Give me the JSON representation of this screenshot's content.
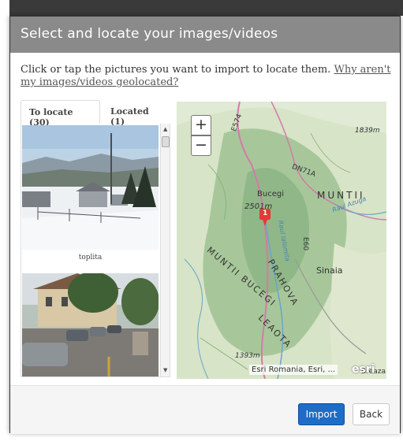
{
  "dialog": {
    "title": "Select and locate your images/videos",
    "intro_text": "Click or tap the pictures you want to import to locate them. ",
    "intro_link": "Why aren't my images/videos geolocated?"
  },
  "tabs": [
    {
      "label": "To locate (30)",
      "active": true
    },
    {
      "label": "Located (1)",
      "active": false
    }
  ],
  "photos": [
    {
      "caption": "toplita"
    },
    {
      "caption": ""
    }
  ],
  "map": {
    "zoom_in": "+",
    "zoom_out": "−",
    "labels": [
      {
        "text": "Bucegi"
      },
      {
        "text": "2501m"
      },
      {
        "text": "MUNTII"
      },
      {
        "text": "Sinaia"
      },
      {
        "text": "PRAHOVA"
      },
      {
        "text": "MUNTII BUCEGI"
      },
      {
        "text": "LEAOTA"
      },
      {
        "text": "1839m"
      },
      {
        "text": "1393m"
      },
      {
        "text": "E574"
      },
      {
        "text": "E60"
      },
      {
        "text": "DN71A"
      },
      {
        "text": "Raul Ialomita"
      },
      {
        "text": "Raul Azuga"
      },
      {
        "text": "Breaza"
      }
    ],
    "marker_label": "1",
    "attribution": "Esri Romania, Esri, ...",
    "logo": "esri"
  },
  "footer": {
    "import_label": "Import",
    "back_label": "Back"
  },
  "colors": {
    "header_bg": "#8a8a8a",
    "primary_button": "#1e6cc5",
    "marker": "#e53935"
  }
}
